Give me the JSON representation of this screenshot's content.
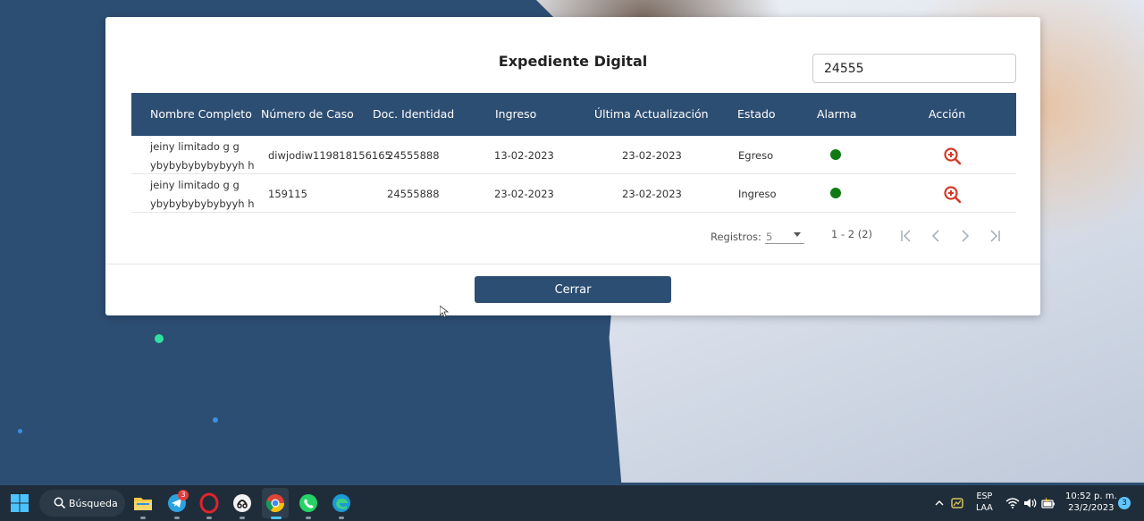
{
  "dialog": {
    "title": "Expediente Digital",
    "search_value": "24555"
  },
  "table": {
    "headers": [
      "Nombre Completo",
      "Número de Caso",
      "Doc. Identidad",
      "Ingreso",
      "Última Actualización",
      "Estado",
      "Alarma",
      "Acción"
    ],
    "rows": [
      {
        "name_line1": "jeiny limitado g g",
        "name_line2": "ybybybybybybyyh h",
        "case_number": "diwjodiw119818156165",
        "doc_id": "24555888",
        "ingreso": "13-02-2023",
        "actualizacion": "23-02-2023",
        "estado": "Egreso",
        "alarm_color": "#0f7a14",
        "action_icon": "zoom-in-icon"
      },
      {
        "name_line1": "jeiny limitado g g",
        "name_line2": "ybybybybybybyyh h",
        "case_number": "159115",
        "doc_id": "24555888",
        "ingreso": "23-02-2023",
        "actualizacion": "23-02-2023",
        "estado": "Ingreso",
        "alarm_color": "#0f7a14",
        "action_icon": "zoom-in-icon"
      }
    ]
  },
  "pager": {
    "label": "Registros:",
    "page_size": "5",
    "range": "1 - 2 (2)"
  },
  "close_label": "Cerrar",
  "taskbar": {
    "search_label": "Búsqueda",
    "telegram_badge": "3",
    "lang_line1": "ESP",
    "lang_line2": "LAA",
    "time": "10:52 p. m.",
    "date": "23/2/2023",
    "notification_count": "3"
  },
  "colors": {
    "primary": "#2d4e73",
    "alarm_ok": "#0f7a14",
    "action_red": "#d23b2a"
  }
}
